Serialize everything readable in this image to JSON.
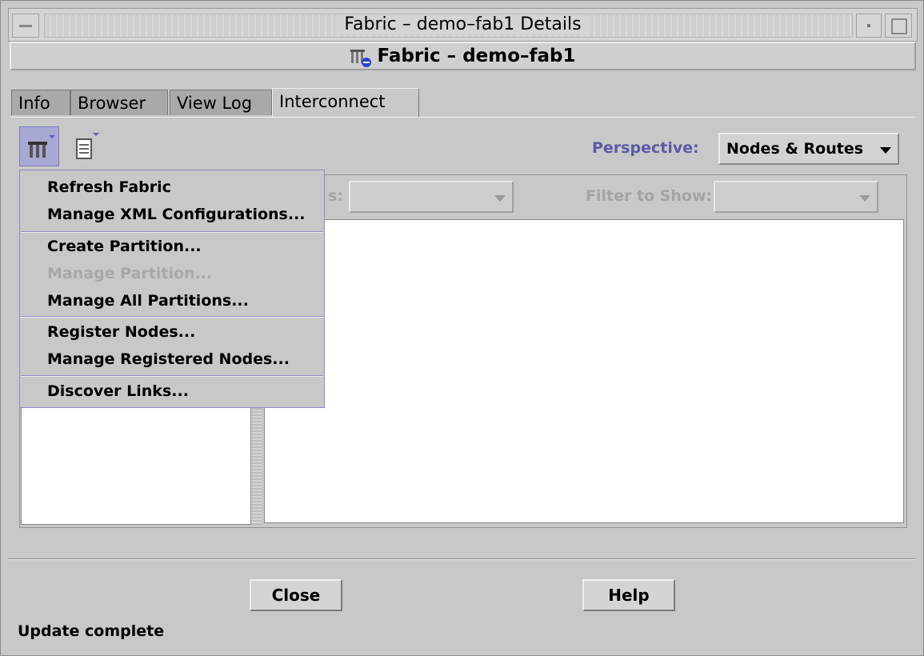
{
  "window": {
    "title": "Fabric – demo–fab1 Details"
  },
  "header": {
    "title": "Fabric – demo–fab1"
  },
  "tabs": [
    {
      "label": "Info"
    },
    {
      "label": "Browser"
    },
    {
      "label": "View Log"
    },
    {
      "label": "Interconnect",
      "active": true
    }
  ],
  "toolbar": {
    "fabric_menu_icon": "fabric-menu-icon",
    "report_menu_icon": "report-menu-icon"
  },
  "perspective": {
    "label": "Perspective:",
    "value": "Nodes & Routes"
  },
  "filters": {
    "filter1_label_visible": "s:",
    "filter1_value": "",
    "filter2_label": "Filter to Show:",
    "filter2_value": ""
  },
  "menu": {
    "items": [
      {
        "label": "Refresh Fabric",
        "enabled": true
      },
      {
        "label": "Manage XML Configurations...",
        "enabled": true
      },
      {
        "label": "Create Partition...",
        "enabled": true
      },
      {
        "label": "Manage Partition...",
        "enabled": false
      },
      {
        "label": "Manage All Partitions...",
        "enabled": true
      },
      {
        "label": "Register Nodes...",
        "enabled": true
      },
      {
        "label": "Manage Registered Nodes...",
        "enabled": true
      },
      {
        "label": "Discover Links...",
        "enabled": true
      }
    ]
  },
  "buttons": {
    "close": "Close",
    "help": "Help"
  },
  "status": {
    "text": "Update complete"
  }
}
